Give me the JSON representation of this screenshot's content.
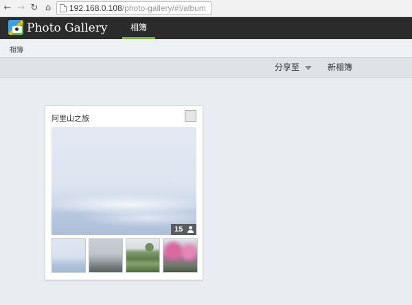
{
  "browser": {
    "url_host": "192.168.0.108",
    "url_path": "/photo-gallery/#!/album"
  },
  "app": {
    "title": "Photo Gallery",
    "nav_tab": "相簿"
  },
  "breadcrumb": {
    "current": "相簿"
  },
  "toolbar": {
    "share_label": "分享至",
    "new_album_label": "新相簿"
  },
  "album": {
    "title": "阿里山之旅",
    "photo_count": "15"
  },
  "colors": {
    "header_bg": "#2b2b2b",
    "tab_underline": "#7cb342",
    "page_bg": "#e9edf1"
  }
}
